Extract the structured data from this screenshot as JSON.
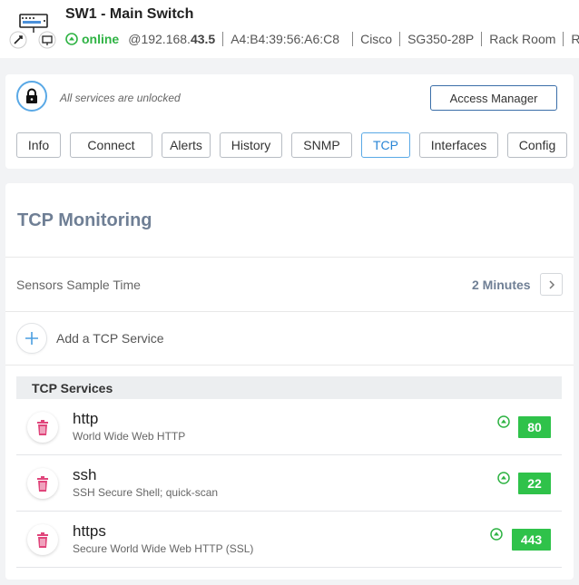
{
  "device": {
    "name": "SW1 - Main Switch",
    "status": "online",
    "ip_prefix": "@192.168.",
    "ip_suffix": "43.5",
    "mac": "A4:B4:39:56:A6:C8",
    "vendor": "Cisco",
    "model": "SG350-28P",
    "location": "Rack Room",
    "extra": "Ra"
  },
  "access": {
    "status_text": "All services are unlocked",
    "button_label": "Access Manager"
  },
  "tabs": [
    {
      "label": "Info",
      "active": false
    },
    {
      "label": "Connect",
      "active": false
    },
    {
      "label": "Alerts",
      "active": false
    },
    {
      "label": "History",
      "active": false
    },
    {
      "label": "SNMP",
      "active": false
    },
    {
      "label": "TCP",
      "active": true
    },
    {
      "label": "Interfaces",
      "active": false
    },
    {
      "label": "Config",
      "active": false
    }
  ],
  "tcp": {
    "title": "TCP Monitoring",
    "sample_label": "Sensors Sample Time",
    "sample_value": "2 Minutes",
    "add_label": "Add a TCP Service",
    "list_header": "TCP Services",
    "services": [
      {
        "name": "http",
        "description": "World Wide Web HTTP",
        "port": "80"
      },
      {
        "name": "ssh",
        "description": "SSH Secure Shell; quick-scan",
        "port": "22"
      },
      {
        "name": "https",
        "description": "Secure World Wide Web HTTP (SSL)",
        "port": "443"
      }
    ]
  },
  "colors": {
    "online": "#2fb344",
    "port_badge": "#2fc24a",
    "accent": "#5aa9e6",
    "title": "#6f7f95",
    "trash": "#e0457b"
  },
  "icons": [
    "switch-icon",
    "lock-icon",
    "chevron-right-icon",
    "plus-icon",
    "trash-icon",
    "status-up-icon"
  ]
}
